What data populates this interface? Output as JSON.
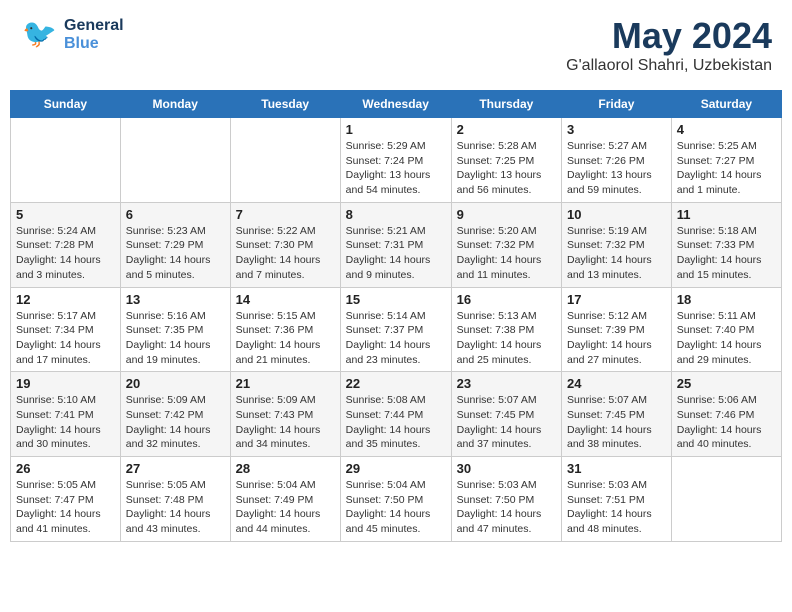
{
  "header": {
    "logo_general": "General",
    "logo_blue": "Blue",
    "month_year": "May 2024",
    "location": "G'allaorol Shahri, Uzbekistan"
  },
  "days_of_week": [
    "Sunday",
    "Monday",
    "Tuesday",
    "Wednesday",
    "Thursday",
    "Friday",
    "Saturday"
  ],
  "weeks": [
    [
      {
        "day": "",
        "info": ""
      },
      {
        "day": "",
        "info": ""
      },
      {
        "day": "",
        "info": ""
      },
      {
        "day": "1",
        "info": "Sunrise: 5:29 AM\nSunset: 7:24 PM\nDaylight: 13 hours\nand 54 minutes."
      },
      {
        "day": "2",
        "info": "Sunrise: 5:28 AM\nSunset: 7:25 PM\nDaylight: 13 hours\nand 56 minutes."
      },
      {
        "day": "3",
        "info": "Sunrise: 5:27 AM\nSunset: 7:26 PM\nDaylight: 13 hours\nand 59 minutes."
      },
      {
        "day": "4",
        "info": "Sunrise: 5:25 AM\nSunset: 7:27 PM\nDaylight: 14 hours\nand 1 minute."
      }
    ],
    [
      {
        "day": "5",
        "info": "Sunrise: 5:24 AM\nSunset: 7:28 PM\nDaylight: 14 hours\nand 3 minutes."
      },
      {
        "day": "6",
        "info": "Sunrise: 5:23 AM\nSunset: 7:29 PM\nDaylight: 14 hours\nand 5 minutes."
      },
      {
        "day": "7",
        "info": "Sunrise: 5:22 AM\nSunset: 7:30 PM\nDaylight: 14 hours\nand 7 minutes."
      },
      {
        "day": "8",
        "info": "Sunrise: 5:21 AM\nSunset: 7:31 PM\nDaylight: 14 hours\nand 9 minutes."
      },
      {
        "day": "9",
        "info": "Sunrise: 5:20 AM\nSunset: 7:32 PM\nDaylight: 14 hours\nand 11 minutes."
      },
      {
        "day": "10",
        "info": "Sunrise: 5:19 AM\nSunset: 7:32 PM\nDaylight: 14 hours\nand 13 minutes."
      },
      {
        "day": "11",
        "info": "Sunrise: 5:18 AM\nSunset: 7:33 PM\nDaylight: 14 hours\nand 15 minutes."
      }
    ],
    [
      {
        "day": "12",
        "info": "Sunrise: 5:17 AM\nSunset: 7:34 PM\nDaylight: 14 hours\nand 17 minutes."
      },
      {
        "day": "13",
        "info": "Sunrise: 5:16 AM\nSunset: 7:35 PM\nDaylight: 14 hours\nand 19 minutes."
      },
      {
        "day": "14",
        "info": "Sunrise: 5:15 AM\nSunset: 7:36 PM\nDaylight: 14 hours\nand 21 minutes."
      },
      {
        "day": "15",
        "info": "Sunrise: 5:14 AM\nSunset: 7:37 PM\nDaylight: 14 hours\nand 23 minutes."
      },
      {
        "day": "16",
        "info": "Sunrise: 5:13 AM\nSunset: 7:38 PM\nDaylight: 14 hours\nand 25 minutes."
      },
      {
        "day": "17",
        "info": "Sunrise: 5:12 AM\nSunset: 7:39 PM\nDaylight: 14 hours\nand 27 minutes."
      },
      {
        "day": "18",
        "info": "Sunrise: 5:11 AM\nSunset: 7:40 PM\nDaylight: 14 hours\nand 29 minutes."
      }
    ],
    [
      {
        "day": "19",
        "info": "Sunrise: 5:10 AM\nSunset: 7:41 PM\nDaylight: 14 hours\nand 30 minutes."
      },
      {
        "day": "20",
        "info": "Sunrise: 5:09 AM\nSunset: 7:42 PM\nDaylight: 14 hours\nand 32 minutes."
      },
      {
        "day": "21",
        "info": "Sunrise: 5:09 AM\nSunset: 7:43 PM\nDaylight: 14 hours\nand 34 minutes."
      },
      {
        "day": "22",
        "info": "Sunrise: 5:08 AM\nSunset: 7:44 PM\nDaylight: 14 hours\nand 35 minutes."
      },
      {
        "day": "23",
        "info": "Sunrise: 5:07 AM\nSunset: 7:45 PM\nDaylight: 14 hours\nand 37 minutes."
      },
      {
        "day": "24",
        "info": "Sunrise: 5:07 AM\nSunset: 7:45 PM\nDaylight: 14 hours\nand 38 minutes."
      },
      {
        "day": "25",
        "info": "Sunrise: 5:06 AM\nSunset: 7:46 PM\nDaylight: 14 hours\nand 40 minutes."
      }
    ],
    [
      {
        "day": "26",
        "info": "Sunrise: 5:05 AM\nSunset: 7:47 PM\nDaylight: 14 hours\nand 41 minutes."
      },
      {
        "day": "27",
        "info": "Sunrise: 5:05 AM\nSunset: 7:48 PM\nDaylight: 14 hours\nand 43 minutes."
      },
      {
        "day": "28",
        "info": "Sunrise: 5:04 AM\nSunset: 7:49 PM\nDaylight: 14 hours\nand 44 minutes."
      },
      {
        "day": "29",
        "info": "Sunrise: 5:04 AM\nSunset: 7:50 PM\nDaylight: 14 hours\nand 45 minutes."
      },
      {
        "day": "30",
        "info": "Sunrise: 5:03 AM\nSunset: 7:50 PM\nDaylight: 14 hours\nand 47 minutes."
      },
      {
        "day": "31",
        "info": "Sunrise: 5:03 AM\nSunset: 7:51 PM\nDaylight: 14 hours\nand 48 minutes."
      },
      {
        "day": "",
        "info": ""
      }
    ]
  ]
}
